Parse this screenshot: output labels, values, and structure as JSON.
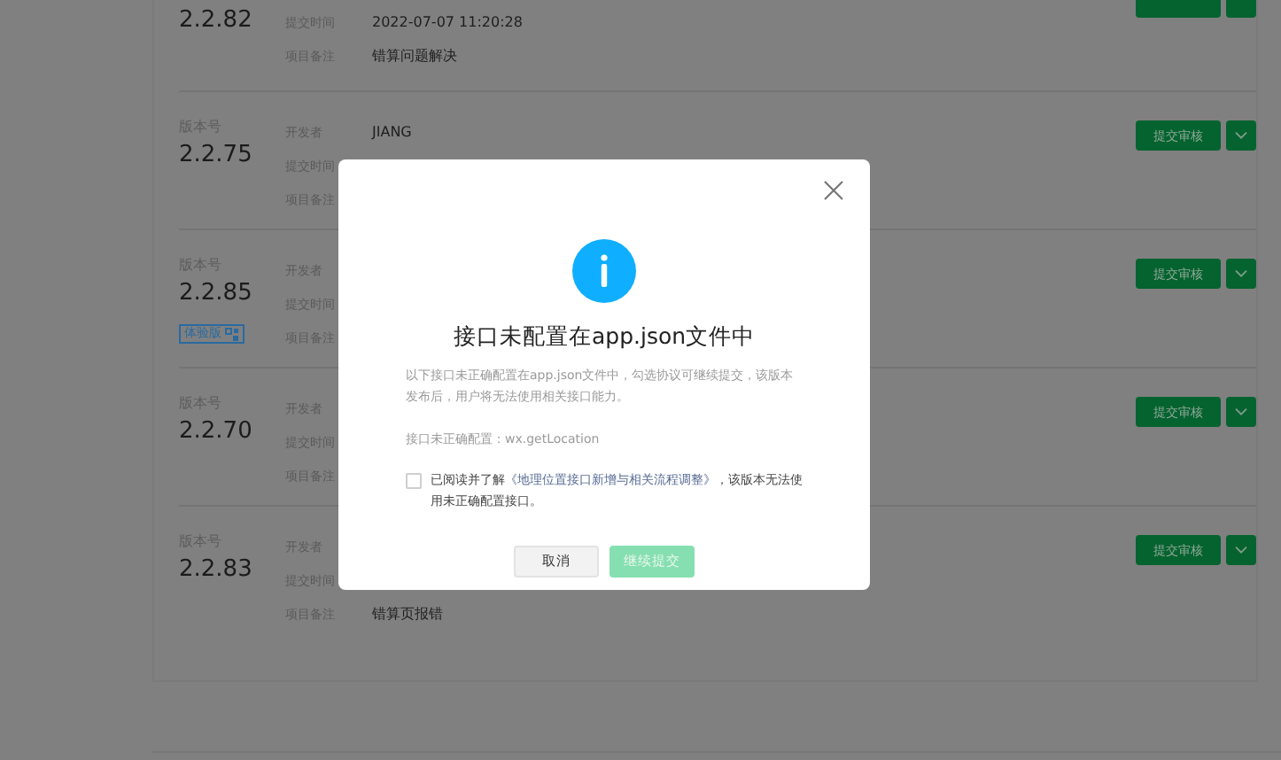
{
  "versions": [
    {
      "version": "2.2.82",
      "fields": [
        {
          "label": "提交时间",
          "value": "2022-07-07 11:20:28"
        },
        {
          "label": "项目备注",
          "value": "错算问题解决"
        }
      ]
    },
    {
      "version_label": "版本号",
      "version": "2.2.75",
      "fields": [
        {
          "label": "开发者",
          "value": "JIANG"
        },
        {
          "label": "提交时间"
        },
        {
          "label": "项目备注"
        }
      ],
      "submit": "提交审核"
    },
    {
      "version_label": "版本号",
      "version": "2.2.85",
      "badge": "体验版",
      "fields": [
        {
          "label": "开发者"
        },
        {
          "label": "提交时间"
        },
        {
          "label": "项目备注"
        }
      ],
      "submit": "提交审核"
    },
    {
      "version_label": "版本号",
      "version": "2.2.70",
      "fields": [
        {
          "label": "开发者"
        },
        {
          "label": "提交时间"
        },
        {
          "label": "项目备注"
        }
      ],
      "submit": "提交审核"
    },
    {
      "version_label": "版本号",
      "version": "2.2.83",
      "fields": [
        {
          "label": "开发者"
        },
        {
          "label": "提交时间"
        },
        {
          "label": "项目备注",
          "value": "错算页报错"
        }
      ],
      "submit": "提交审核"
    }
  ],
  "dialog": {
    "title": "接口未配置在app.json文件中",
    "description": "以下接口未正确配置在app.json文件中，勾选协议可继续提交，该版本发布后，用户将无法使用相关接口能力。",
    "api_line": "接口未正确配置：wx.getLocation",
    "agreement": {
      "checked": false,
      "before": "已阅读并了解",
      "link": "《地理位置接口新增与相关流程调整》",
      "after": "，该版本无法使用未正确配置接口。"
    },
    "buttons": [
      {
        "label": "取消",
        "kind": "secondary",
        "disabled": false
      },
      {
        "label": "继续提交",
        "kind": "primary",
        "disabled": true
      }
    ]
  }
}
